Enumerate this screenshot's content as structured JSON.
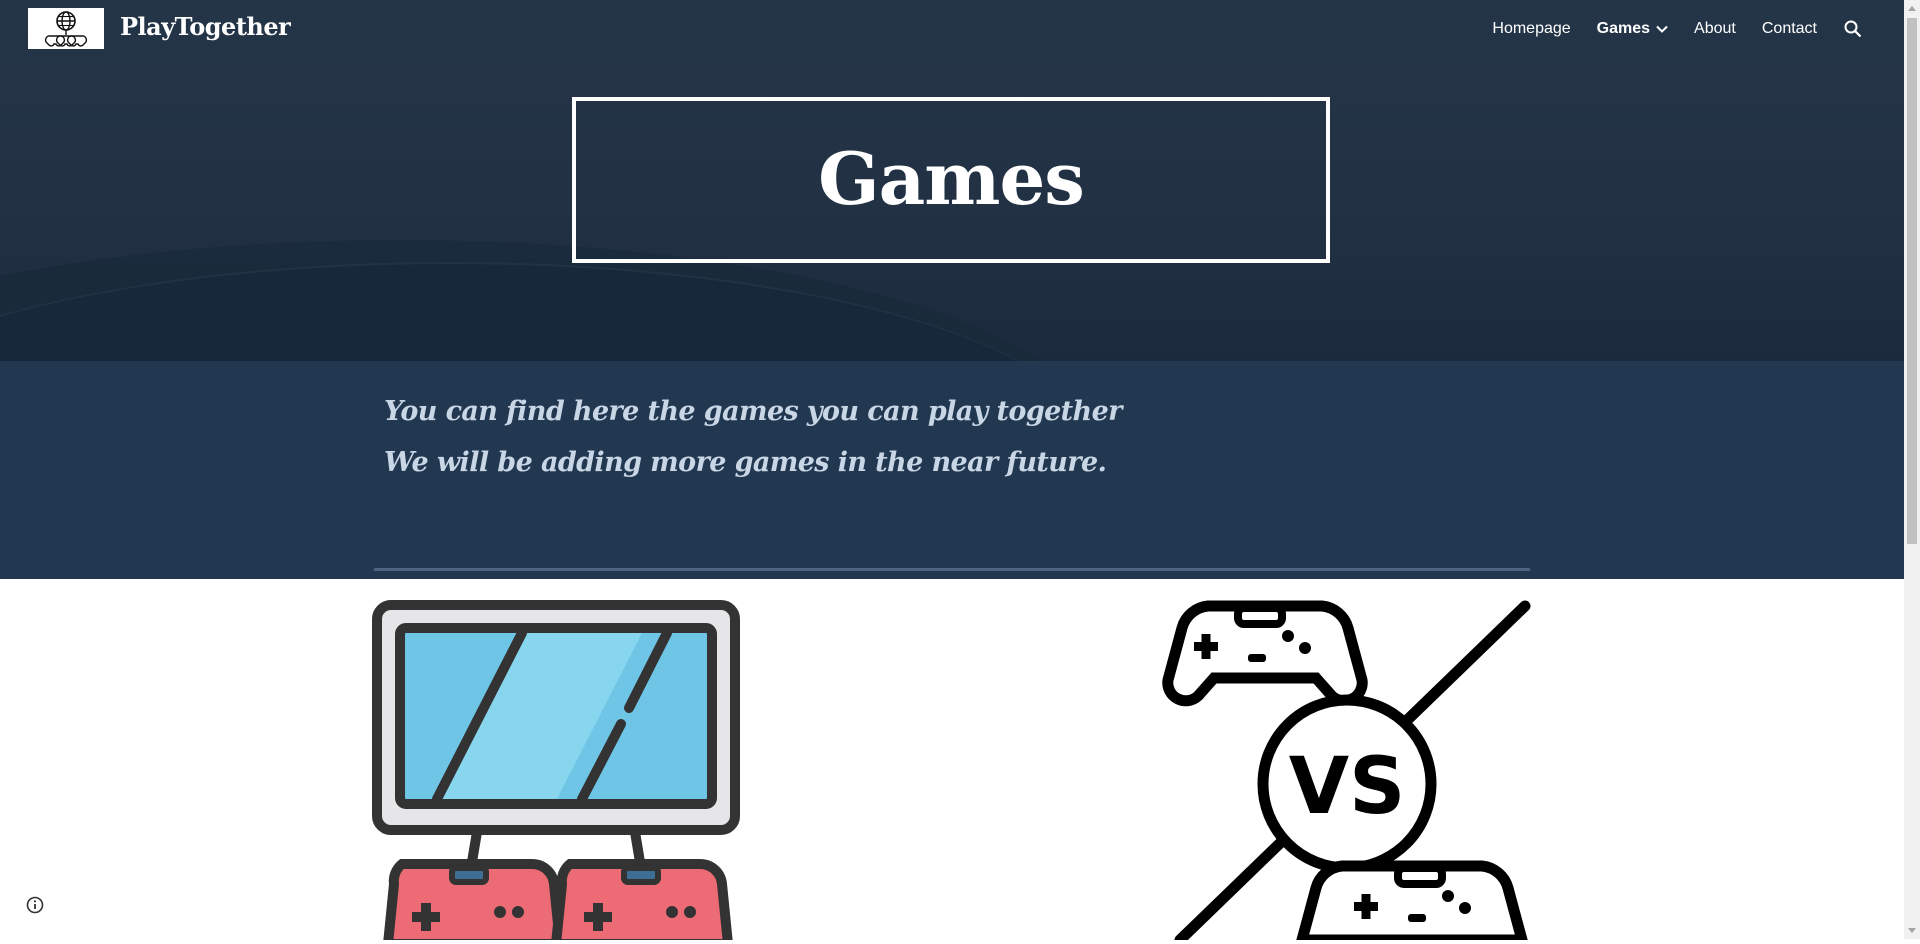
{
  "site": {
    "title": "PlayTogether",
    "logo_icon": "globe-controllers-logo"
  },
  "nav": {
    "items": [
      {
        "label": "Homepage",
        "active": false
      },
      {
        "label": "Games",
        "active": true,
        "has_dropdown": true
      },
      {
        "label": "About",
        "active": false
      },
      {
        "label": "Contact",
        "active": false
      }
    ],
    "search_icon": "search-icon"
  },
  "hero": {
    "title": "Games"
  },
  "intro": {
    "line1": "You can find here the games you can play together",
    "line2": "We will be adding more games in the near future."
  },
  "images": {
    "left_icon": "shared-screen-two-controllers-icon",
    "right_icon": "versus-controllers-icon",
    "right_vs_text": "VS"
  },
  "colors": {
    "hero_bg": "#223244",
    "intro_bg": "#223750",
    "intro_text": "#c9d6e6",
    "screen_blue": "#6ec5e6",
    "controller_pink": "#ec6b74",
    "outline": "#333333"
  }
}
